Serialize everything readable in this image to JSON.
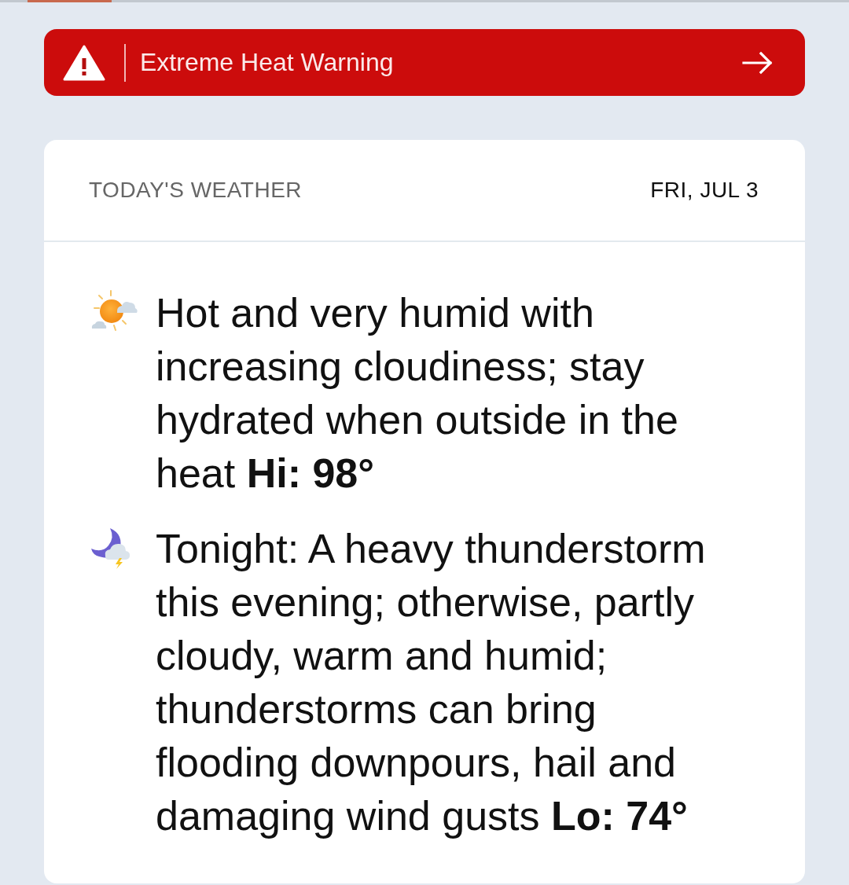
{
  "alert": {
    "title": "Extreme Heat Warning"
  },
  "card": {
    "title": "TODAY'S WEATHER",
    "date": "FRI, JUL 3"
  },
  "forecasts": [
    {
      "kind": "day",
      "text": "Hot and very humid with increasing cloudiness; stay hydrated when outside in the heat **Hi: 98°**"
    },
    {
      "kind": "night",
      "text": "Tonight: A heavy thunderstorm this evening; otherwise, partly cloudy, warm and humid; thunderstorms can bring flooding downpours, hail and damaging wind gusts **Lo: 74°**"
    }
  ]
}
